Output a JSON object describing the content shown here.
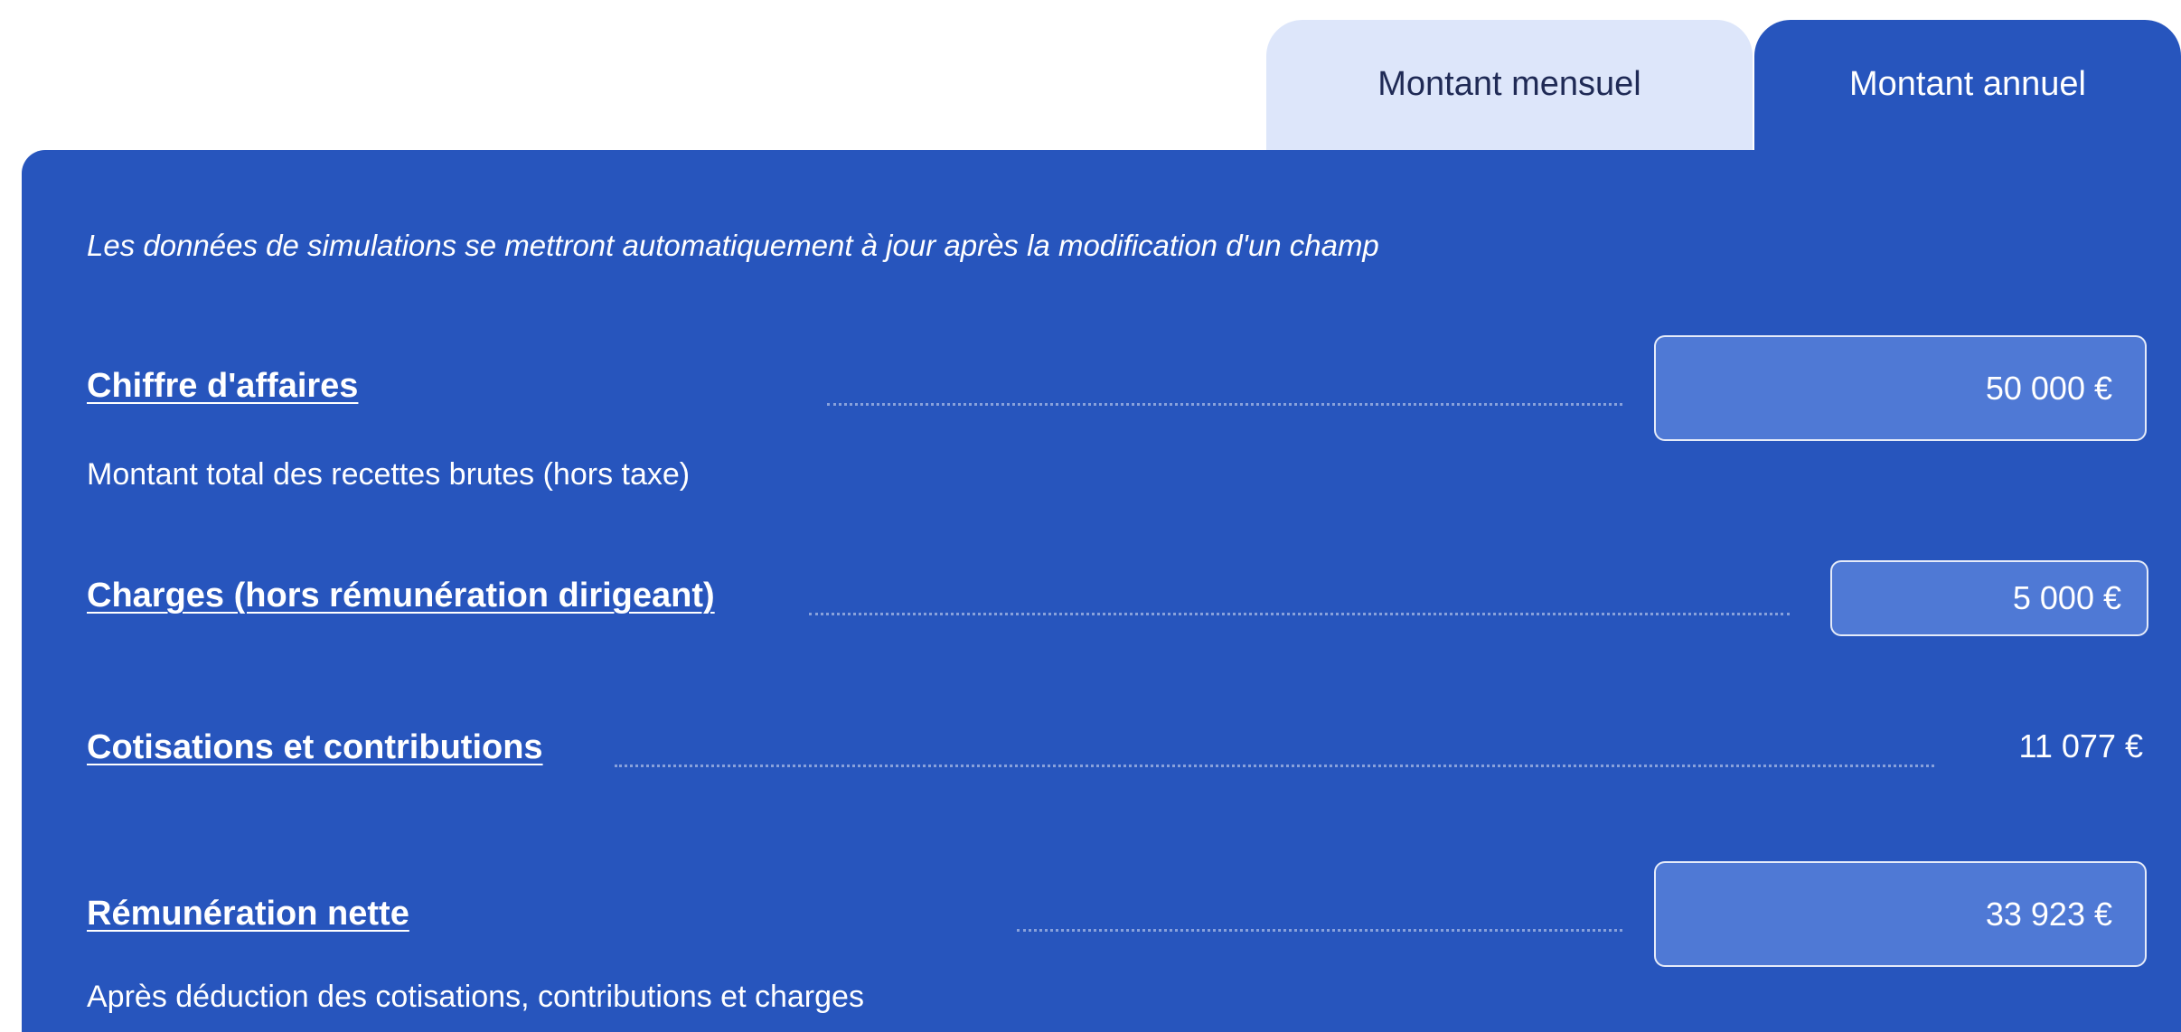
{
  "tabs": {
    "monthly": "Montant mensuel",
    "annual": "Montant annuel",
    "active": "annual"
  },
  "hint": "Les données de simulations se mettront automatiquement à jour après la modification d'un champ",
  "fields": {
    "revenue": {
      "label": "Chiffre d'affaires",
      "value": "50 000 €",
      "description": "Montant total des recettes brutes (hors taxe)"
    },
    "charges": {
      "label": "Charges (hors rémunération dirigeant)",
      "value": "5 000 €"
    },
    "contributions": {
      "label": "Cotisations et contributions",
      "value": "11 077 €"
    },
    "net_pay": {
      "label": "Rémunération nette",
      "value": "33 923 €",
      "description": "Après déduction des cotisations, contributions et charges"
    }
  },
  "colors": {
    "panel": "#2755bd",
    "tab_inactive": "#dde6fa",
    "input_fill": "#4f79d5"
  }
}
